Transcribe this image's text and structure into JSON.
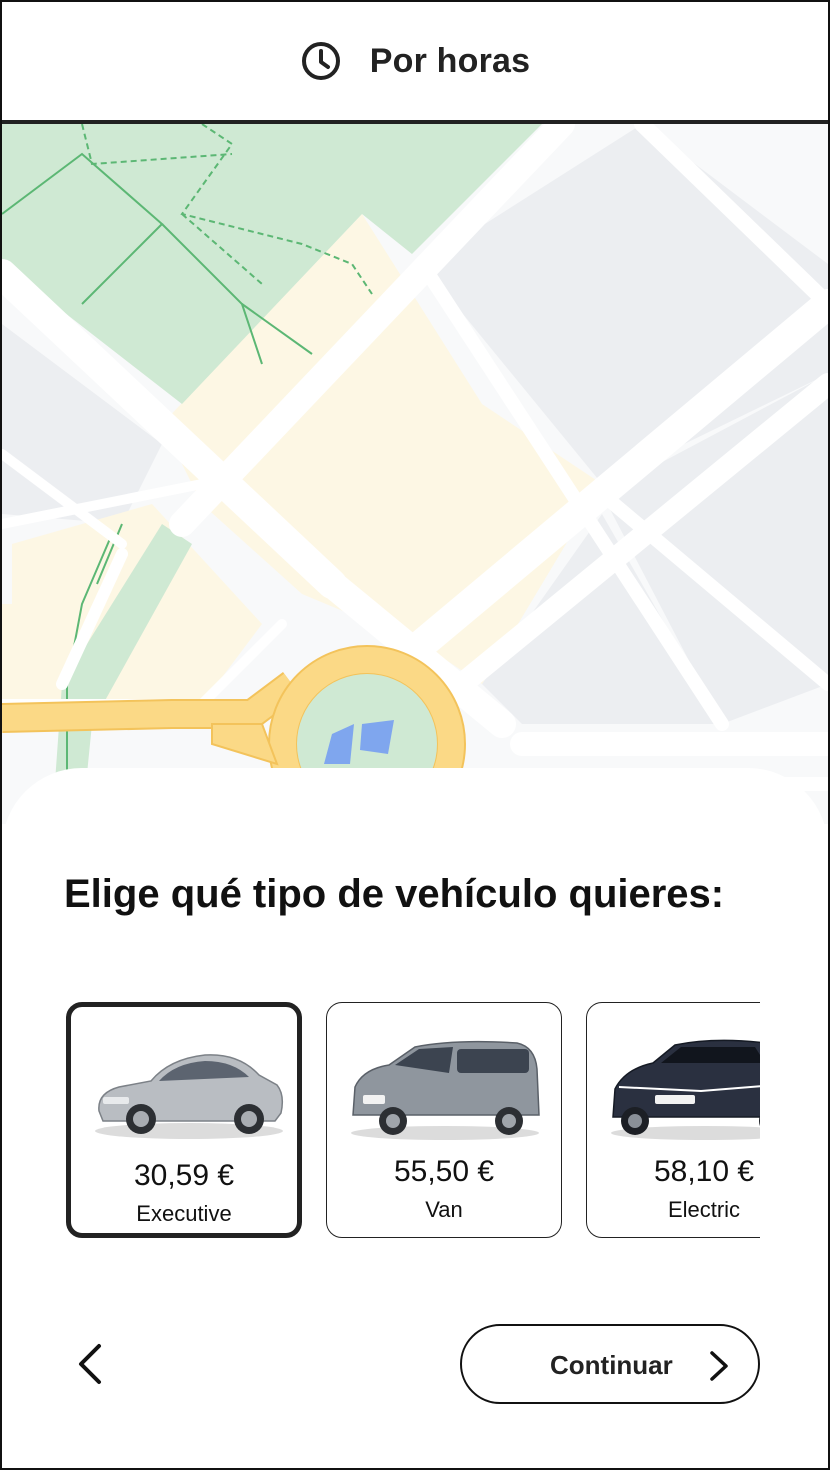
{
  "header": {
    "title": "Por horas",
    "icon": "clock-icon"
  },
  "map": {
    "colors": {
      "park": "#cfe9d3",
      "land": "#fdf7e4",
      "block": "#eceef1",
      "road": "#ffffff",
      "major_road": "#fbd986",
      "major_road_edge": "#f3c35b",
      "water": "#7fa6ee",
      "path": "#5cb774"
    }
  },
  "sheet": {
    "question": "Elige qué tipo de vehículo quieres:"
  },
  "vehicles": [
    {
      "price": "30,59 €",
      "label": "Executive",
      "selected": true,
      "icon": "sedan-car-image",
      "body_color": "#b9bdc2"
    },
    {
      "price": "55,50 €",
      "label": "Van",
      "selected": false,
      "icon": "van-car-image",
      "body_color": "#8f969e"
    },
    {
      "price": "58,10 €",
      "label": "Electric",
      "selected": false,
      "icon": "electric-suv-image",
      "body_color": "#2a3040"
    }
  ],
  "footer": {
    "back_icon": "chevron-left-icon",
    "continue_label": "Continuar",
    "continue_icon": "chevron-right-icon"
  }
}
